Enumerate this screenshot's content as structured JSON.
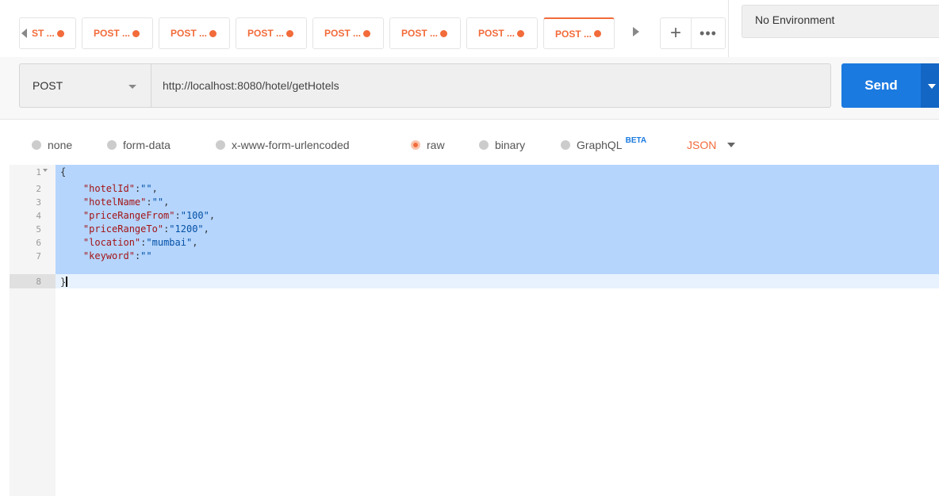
{
  "tabs": {
    "prev_label": "ST ...",
    "items": [
      {
        "label": "POST ..."
      },
      {
        "label": "POST ..."
      },
      {
        "label": "POST ..."
      },
      {
        "label": "POST ..."
      },
      {
        "label": "POST ..."
      },
      {
        "label": "POST ..."
      },
      {
        "label": "POST ...",
        "active": true
      }
    ],
    "add_label": "+",
    "more_label": "•••"
  },
  "environment": {
    "label": "No Environment"
  },
  "request": {
    "method": "POST",
    "url": "http://localhost:8080/hotel/getHotels",
    "send_label": "Send"
  },
  "body_types": {
    "none": "none",
    "form_data": "form-data",
    "urlencoded": "x-www-form-urlencoded",
    "raw": "raw",
    "binary": "binary",
    "graphql": "GraphQL",
    "beta": "BETA",
    "format": "JSON",
    "selected": "raw"
  },
  "editor": {
    "line_numbers": [
      "1",
      "2",
      "3",
      "4",
      "5",
      "6",
      "7",
      "8"
    ],
    "lines": [
      {
        "key": "\"hotelId\"",
        "val": "\"\"",
        "trail": ","
      },
      {
        "key": "\"hotelName\"",
        "val": "\"\"",
        "trail": ","
      },
      {
        "key": "\"priceRangeFrom\"",
        "val": "\"100\"",
        "trail": ","
      },
      {
        "key": "\"priceRangeTo\"",
        "val": "\"1200\"",
        "trail": ","
      },
      {
        "key": "\"location\"",
        "val": "\"mumbai\"",
        "trail": ","
      },
      {
        "key": "\"keyword\"",
        "val": "\"\"",
        "trail": ""
      }
    ],
    "open_brace": "{",
    "close_brace": "}",
    "colon": ":"
  },
  "colors": {
    "accent": "#f26b3a",
    "send": "#1b7ae0",
    "selection": "#b5d5fd"
  }
}
